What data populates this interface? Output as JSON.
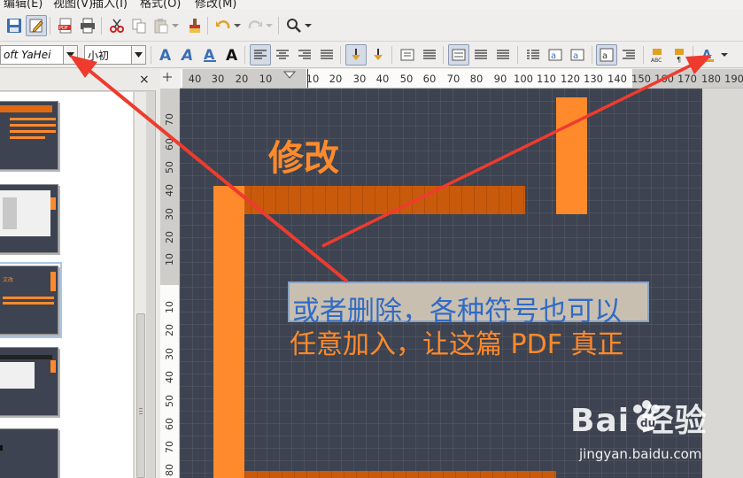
{
  "menu": {
    "items": [
      "编辑(E)",
      "视图(V)",
      "插入(I)",
      "格式(O)",
      "修改(M)"
    ]
  },
  "font": {
    "name": "oft YaHei",
    "size": "小初"
  },
  "icons": {
    "save": "save-icon",
    "edit_mode": "edit-mode-icon",
    "export_pdf": "export-pdf-icon",
    "print": "print-icon",
    "cut": "cut-icon",
    "copy": "copy-icon",
    "paste": "paste-icon",
    "clone": "clone-formatting-icon",
    "undo": "undo-icon",
    "redo": "redo-icon",
    "find": "find-icon"
  },
  "panel": {
    "close_label": "×"
  },
  "rulers": {
    "horizontal": [
      "40",
      "30",
      "20",
      "10",
      "10",
      "20",
      "30",
      "40",
      "50",
      "60",
      "70",
      "80",
      "90",
      "100",
      "110",
      "120",
      "130",
      "140",
      "150",
      "160",
      "170",
      "180",
      "190"
    ],
    "vertical_top": [
      "70",
      "60",
      "50",
      "40",
      "30",
      "20",
      "10"
    ],
    "vertical_bottom": [
      "10",
      "20",
      "30",
      "40",
      "50",
      "60",
      "70",
      "80"
    ]
  },
  "slide": {
    "title": "修改",
    "line1": "或者删除，各种符号也可以",
    "line2": "任意加入，让这篇 PDF 真正",
    "watermark_main": "Bai  经验",
    "watermark_sub": "jingyan.baidu.com"
  },
  "thumbnails": {
    "t3_text": "文改"
  },
  "colors": {
    "slide_bg": "#3d4350",
    "accent_orange": "#ff8a2c",
    "band_orange": "#c95a0c",
    "annotation_red": "#ee3b2e",
    "selection_blue": "#2f6bc4"
  }
}
